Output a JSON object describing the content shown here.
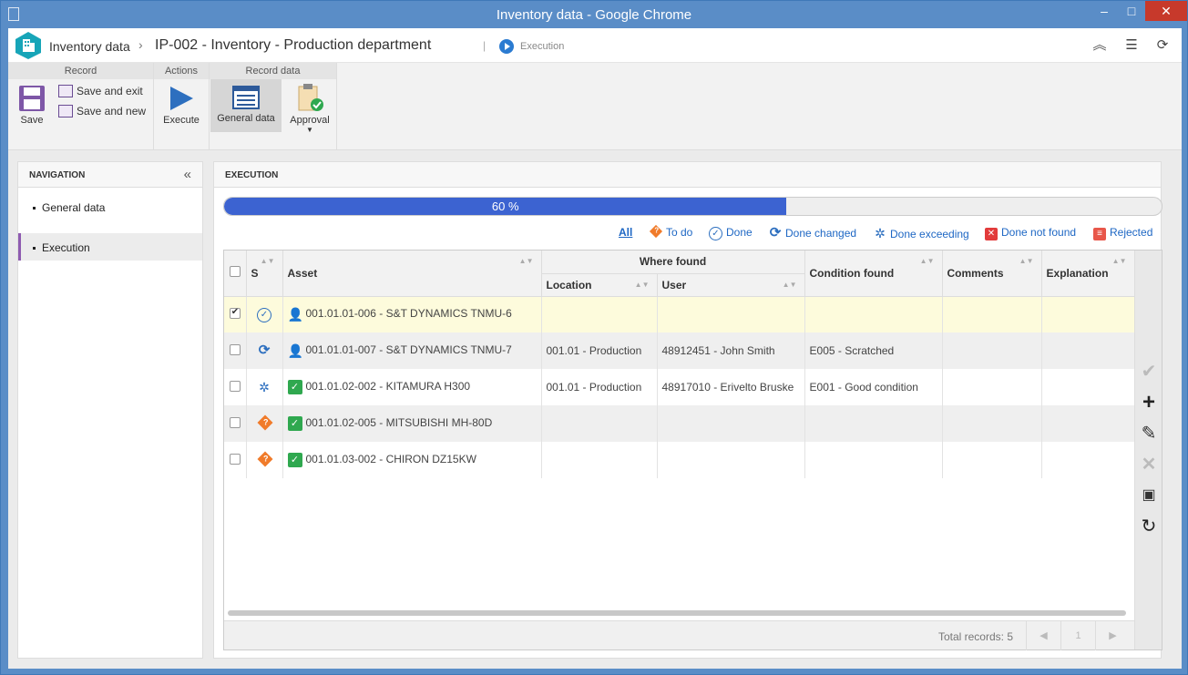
{
  "window": {
    "title": "Inventory data - Google Chrome"
  },
  "header": {
    "breadcrumb_root": "Inventory data",
    "title": "IP-002 - Inventory - Production department",
    "status": "Execution"
  },
  "ribbon": {
    "groups": {
      "record": "Record",
      "actions": "Actions",
      "record_data": "Record data"
    },
    "save": "Save",
    "save_and_exit": "Save and exit",
    "save_and_new": "Save and new",
    "execute": "Execute",
    "general_data": "General data",
    "approval": "Approval"
  },
  "navigation": {
    "heading": "NAVIGATION",
    "items": [
      {
        "label": "General data"
      },
      {
        "label": "Execution"
      }
    ],
    "active": "Execution"
  },
  "execution": {
    "heading": "EXECUTION",
    "progress_label": "60 %",
    "progress_value": 0.6,
    "filters": {
      "all": "All",
      "todo": "To do",
      "done": "Done",
      "done_changed": "Done changed",
      "done_exceeding": "Done exceeding",
      "done_not_found": "Done not found",
      "rejected": "Rejected"
    }
  },
  "grid": {
    "columns": {
      "s": "S",
      "asset": "Asset",
      "where_found": "Where found",
      "location": "Location",
      "user": "User",
      "condition": "Condition found",
      "comments": "Comments",
      "explanation": "Explanation"
    },
    "rows": [
      {
        "checked": true,
        "status": "done",
        "asset_icon": "user-icon",
        "asset": "001.01.01-006 - S&T DYNAMICS TNMU-6",
        "location": "",
        "user": "",
        "condition": "",
        "comments": "",
        "explanation": ""
      },
      {
        "checked": false,
        "status": "done-changed",
        "asset_icon": "user-icon",
        "asset": "001.01.01-007 - S&T DYNAMICS TNMU-7",
        "location": "001.01 - Production",
        "user": "48912451 - John Smith",
        "condition": "E005 - Scratched",
        "comments": "",
        "explanation": ""
      },
      {
        "checked": false,
        "status": "done-exceeding",
        "asset_icon": "check-icon",
        "asset": "001.01.02-002 - KITAMURA H300",
        "location": "001.01 - Production",
        "user": "48917010 - Erivelto Bruske",
        "condition": "E001 - Good condition",
        "comments": "",
        "explanation": ""
      },
      {
        "checked": false,
        "status": "to-do",
        "asset_icon": "check-icon",
        "asset": "001.01.02-005 - MITSUBISHI MH-80D",
        "location": "",
        "user": "",
        "condition": "",
        "comments": "",
        "explanation": ""
      },
      {
        "checked": false,
        "status": "to-do",
        "asset_icon": "check-icon",
        "asset": "001.01.03-002 - CHIRON DZ15KW",
        "location": "",
        "user": "",
        "condition": "",
        "comments": "",
        "explanation": ""
      }
    ],
    "total_records": "Total records: 5",
    "page": "1"
  },
  "colors": {
    "accent": "#3c63d1",
    "titlebar": "#5a8dc7",
    "selected_row": "#fdfbdc",
    "nav_active": "#8e5bb0"
  }
}
